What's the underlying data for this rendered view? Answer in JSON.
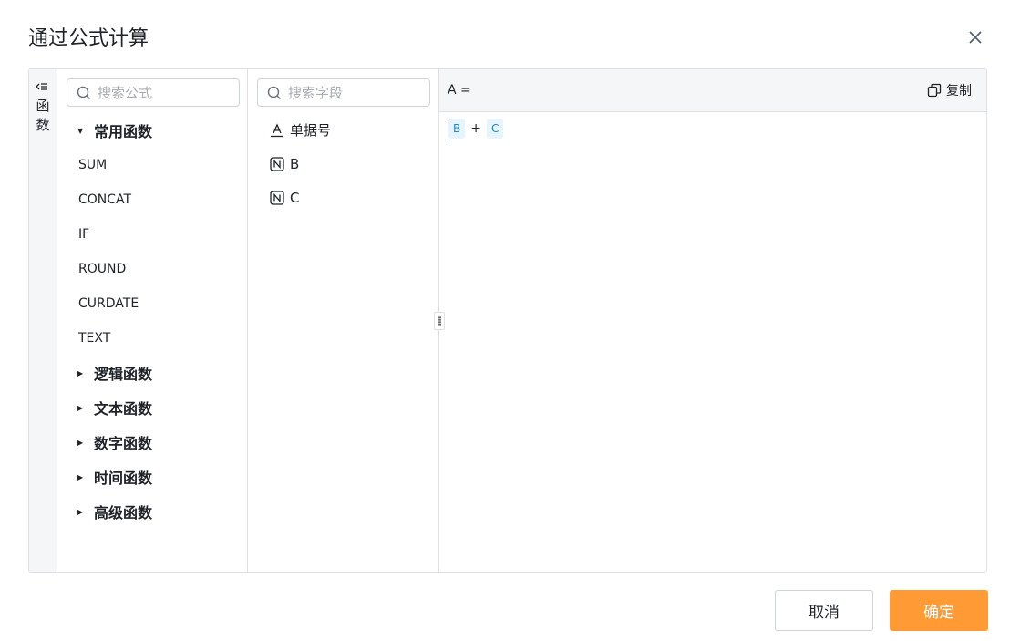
{
  "dialog": {
    "title": "通过公式计算",
    "cancel_label": "取消",
    "confirm_label": "确定"
  },
  "sidebar": {
    "collapse_label": "函数"
  },
  "functions": {
    "search_placeholder": "搜索公式",
    "groups": [
      {
        "label": "常用函数",
        "expanded": true,
        "items": [
          "SUM",
          "CONCAT",
          "IF",
          "ROUND",
          "CURDATE",
          "TEXT"
        ]
      },
      {
        "label": "逻辑函数",
        "expanded": false
      },
      {
        "label": "文本函数",
        "expanded": false
      },
      {
        "label": "数字函数",
        "expanded": false
      },
      {
        "label": "时间函数",
        "expanded": false
      },
      {
        "label": "高级函数",
        "expanded": false
      }
    ]
  },
  "fields": {
    "search_placeholder": "搜索字段",
    "items": [
      {
        "label": "单据号",
        "icon": "text-field-icon"
      },
      {
        "label": "B",
        "icon": "number-field-icon"
      },
      {
        "label": "C",
        "icon": "number-field-icon"
      }
    ]
  },
  "editor": {
    "target": "A =",
    "copy_label": "复制",
    "formula": {
      "left": "B",
      "operator": "+",
      "right": "C"
    }
  },
  "colors": {
    "accent": "#ff9a35",
    "tag_bg": "#e6f4fd",
    "tag_text": "#1e88c8",
    "border": "#dee0e3"
  }
}
